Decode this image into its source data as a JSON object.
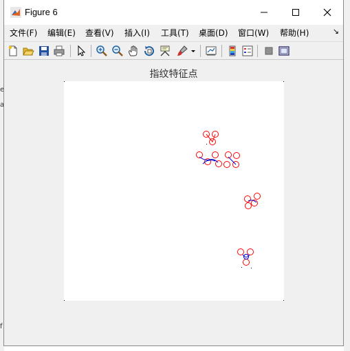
{
  "window": {
    "title": "Figure 6",
    "controls": {
      "minimize": "minimize",
      "maximize": "maximize",
      "close": "close"
    }
  },
  "menu": {
    "items": [
      {
        "label": "文件(F)"
      },
      {
        "label": "编辑(E)"
      },
      {
        "label": "查看(V)"
      },
      {
        "label": "插入(I)"
      },
      {
        "label": "工具(T)"
      },
      {
        "label": "桌面(D)"
      },
      {
        "label": "窗口(W)"
      },
      {
        "label": "帮助(H)"
      }
    ],
    "overflow": "↘"
  },
  "toolbar": {
    "icons": [
      "new-figure-icon",
      "open-file-icon",
      "save-icon",
      "print-icon",
      "select-pointer-icon",
      "zoom-in-icon",
      "zoom-out-icon",
      "pan-hand-icon",
      "rotate-3d-icon",
      "data-cursor-icon",
      "brush-icon",
      "brush-dropdown-icon",
      "link-plot-icon",
      "colorbar-icon",
      "legend-icon",
      "hide-plot-tools-icon",
      "show-plot-tools-icon"
    ]
  },
  "axes": {
    "title": "指纹特征点"
  },
  "background": {
    "fragments": [
      "er",
      "a",
      "f",
      "4",
      "5"
    ]
  },
  "colors": {
    "marker": "#ff0000",
    "line": "#0000cc",
    "window_bg": "#f0f0f0",
    "axes_bg": "#ffffff"
  }
}
